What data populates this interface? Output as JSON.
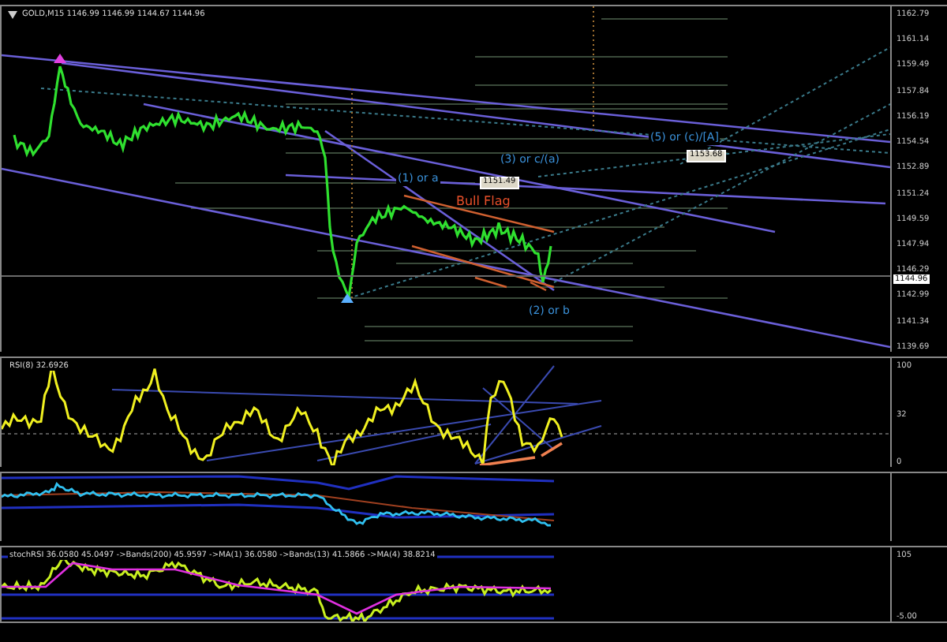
{
  "main_chart": {
    "symbol_header": "GOLD,M15  1146.99 1146.99 1144.67 1144.96",
    "price_axis": [
      "1162.79",
      "1161.14",
      "1159.49",
      "1157.84",
      "1156.19",
      "1154.54",
      "1152.89",
      "1151.24",
      "1149.59",
      "1147.94",
      "1146.29",
      "1142.99",
      "1141.34",
      "1139.69"
    ],
    "current_price": "1144.96",
    "annotations": [
      {
        "kind": "wave",
        "text": "(5) or (c)/[A]"
      },
      {
        "kind": "wave",
        "text": "(3) or c/(a)"
      },
      {
        "kind": "wave",
        "text": "(1) or a"
      },
      {
        "kind": "pattern",
        "text": "Bull Flag"
      },
      {
        "kind": "wave",
        "text": "(2) or b"
      },
      {
        "kind": "price",
        "text": "1153.68"
      },
      {
        "kind": "price",
        "text": "1151.49"
      }
    ]
  },
  "rsi_pane": {
    "header": "RSI(8) 32.6926",
    "axis": [
      "100",
      "32",
      "0"
    ]
  },
  "stoch_pane": {
    "header": "stochRSI 36.0580 45.0497 ->Bands(200) 45.9597 ->MA(1) 36.0580 ->Bands(13) 41.5866 ->MA(4) 38.8214",
    "axis": [
      "105",
      "-5.00"
    ]
  }
}
